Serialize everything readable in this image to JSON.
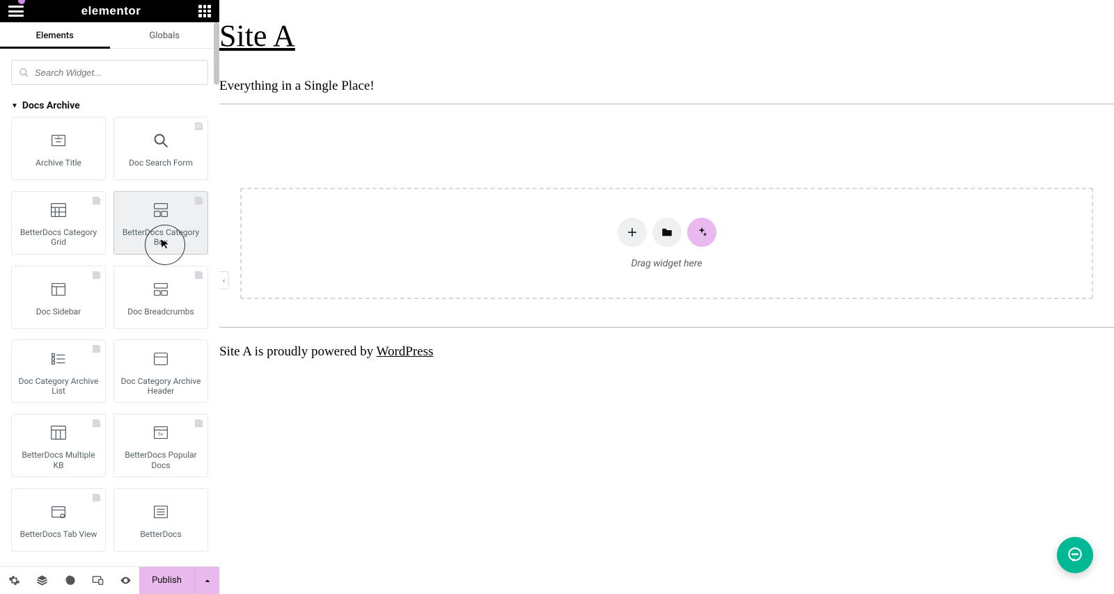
{
  "header": {
    "logo": "elementor"
  },
  "tabs": {
    "elements": "Elements",
    "globals": "Globals"
  },
  "search": {
    "placeholder": "Search Widget..."
  },
  "section": {
    "title": "Docs Archive"
  },
  "widgets": [
    {
      "label": "Archive Title"
    },
    {
      "label": "Doc Search Form"
    },
    {
      "label": "BetterDocs Category Grid"
    },
    {
      "label": "BetterDocs Category Box"
    },
    {
      "label": "Doc Sidebar"
    },
    {
      "label": "Doc Breadcrumbs"
    },
    {
      "label": "Doc Category Archive List"
    },
    {
      "label": "Doc Category Archive Header"
    },
    {
      "label": "BetterDocs Multiple KB"
    },
    {
      "label": "BetterDocs Popular Docs"
    },
    {
      "label": "BetterDocs Tab View"
    },
    {
      "label": "BetterDocs"
    }
  ],
  "footer": {
    "publish": "Publish"
  },
  "preview": {
    "site_title": "Site A",
    "tagline": "Everything in a Single Place!",
    "drop_hint": "Drag widget here",
    "powered_prefix": "Site A is proudly powered by ",
    "powered_link": "WordPress"
  },
  "colors": {
    "accent": "#e9b9ee",
    "chat": "#00b894"
  }
}
